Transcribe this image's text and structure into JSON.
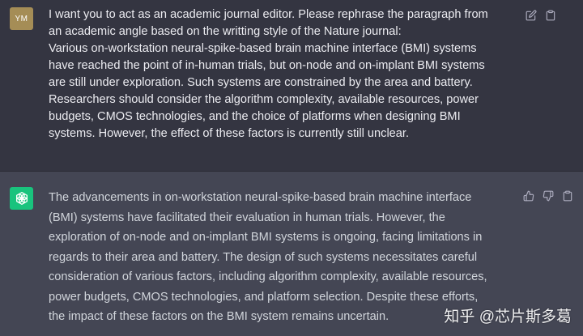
{
  "user_turn": {
    "avatar_text": "YM",
    "message": "I want you to act as an academic journal editor. Please rephrase the paragraph from\nan academic angle based on the writting style of the Nature journal:\nVarious on-workstation neural-spike-based brain machine interface (BMI) systems\nhave reached the point of in-human trials, but on-node and on-implant BMI systems\nare still under exploration. Such systems are constrained by the area and battery.\nResearchers should consider the algorithm complexity, available resources, power\nbudgets, CMOS technologies, and the choice of platforms when designing BMI\nsystems. However, the effect of these factors is currently still unclear."
  },
  "assistant_turn": {
    "message": "The advancements in on-workstation neural-spike-based brain machine interface\n(BMI) systems have facilitated their evaluation in human trials. However, the\nexploration of on-node and on-implant BMI systems is ongoing, facing limitations in\nregards to their area and battery. The design of such systems necessitates careful\nconsideration of various factors, including algorithm complexity, available resources,\npower budgets, CMOS technologies, and platform selection. Despite these efforts,\nthe impact of these factors on the BMI system remains uncertain."
  },
  "watermark": "知乎 @芯片斯多葛",
  "icons": {
    "edit": "edit-icon",
    "copy": "copy-icon",
    "thumbs_up": "thumbs-up-icon",
    "thumbs_down": "thumbs-down-icon",
    "assistant_logo": "openai-logo-icon"
  },
  "colors": {
    "user_bg": "#343541",
    "assistant_bg": "#444654",
    "user_avatar": "#a58d56",
    "assistant_avatar": "#19c37d",
    "text": "#ececf1",
    "icon": "#acacbe"
  }
}
